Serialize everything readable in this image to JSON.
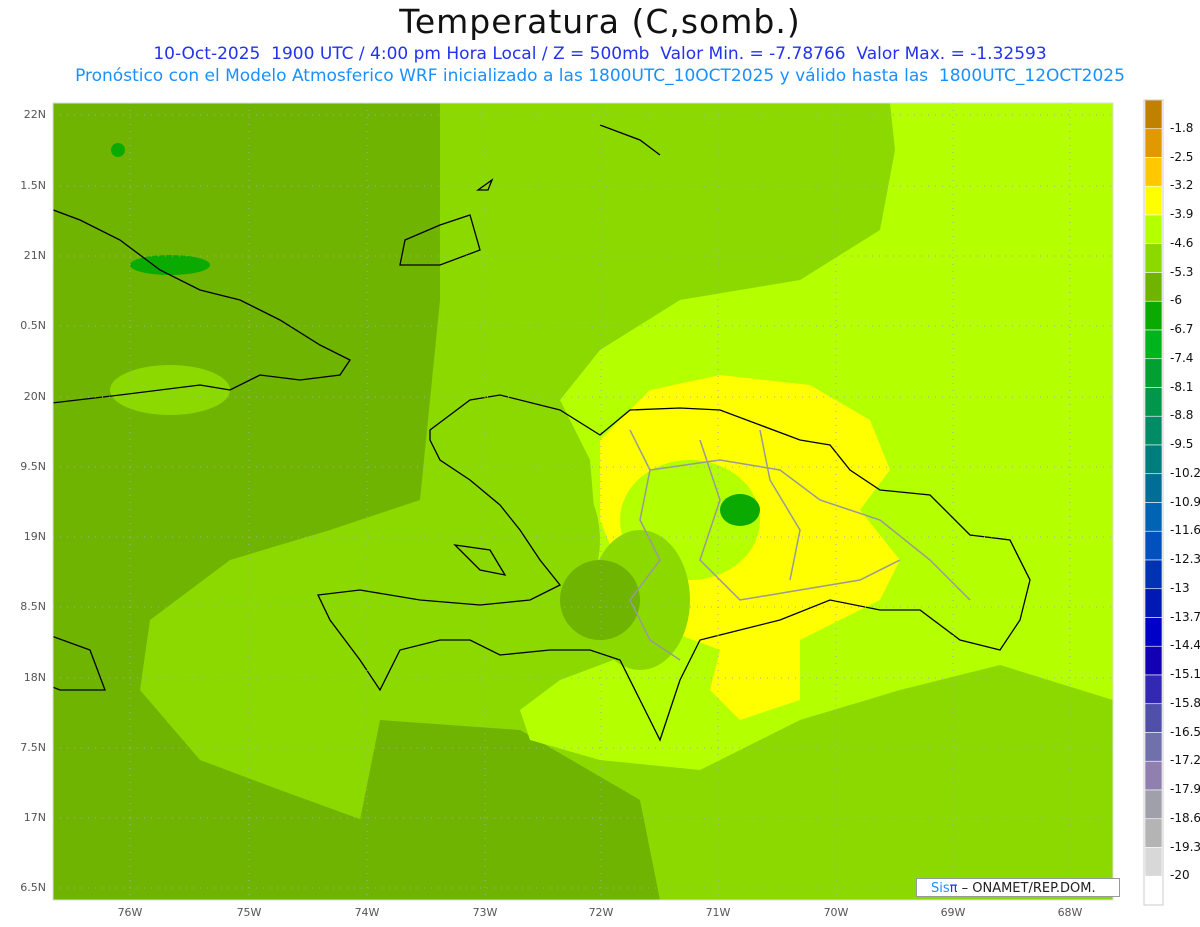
{
  "header": {
    "title": "Temperatura (C,somb.)",
    "line1": "10-Oct-2025  1900 UTC / 4:00 pm Hora Local / Z = 500mb  Valor Min. = -7.78766  Valor Max. = -1.32593",
    "line2": "Pronóstico con el Modelo Atmosferico WRF inicializado a las 1800UTC_10OCT2025 y válido hasta las  1800UTC_12OCT2025"
  },
  "axes": {
    "lon_labels": [
      "76W",
      "75W",
      "74W",
      "73W",
      "72W",
      "71W",
      "70W",
      "69W",
      "68W"
    ],
    "lat_labels": [
      "22N",
      "1.5N",
      "21N",
      "0.5N",
      "20N",
      "9.5N",
      "19N",
      "8.5N",
      "18N",
      "7.5N",
      "17N",
      "6.5N"
    ]
  },
  "colorbar": {
    "labels": [
      "-1.8",
      "-2.5",
      "-3.2",
      "-3.9",
      "-4.6",
      "-5.3",
      "-6",
      "-6.7",
      "-7.4",
      "-8.1",
      "-8.8",
      "-9.5",
      "-10.2",
      "-10.9",
      "-11.6",
      "-12.3",
      "-13",
      "-13.7",
      "-14.4",
      "-15.1",
      "-15.8",
      "-16.5",
      "-17.2",
      "-17.9",
      "-18.6",
      "-19.3",
      "-20"
    ],
    "colors": [
      "#c08000",
      "#e09a00",
      "#ffc800",
      "#ffff00",
      "#b4ff00",
      "#8cd900",
      "#6eb400",
      "#0aaa00",
      "#00b41e",
      "#00a032",
      "#00964b",
      "#008c64",
      "#007e7e",
      "#006e96",
      "#0064b4",
      "#0050be",
      "#0032b4",
      "#0019b4",
      "#0000c8",
      "#1400b4",
      "#3228b4",
      "#5050aa",
      "#7070aa",
      "#9080b0",
      "#a0a0aa",
      "#b4b4b4",
      "#d8d8d8",
      "#ffffff"
    ]
  },
  "credit": {
    "brand": "Sis",
    "pi": "π",
    "org": " –  ONAMET/REP.DOM."
  }
}
